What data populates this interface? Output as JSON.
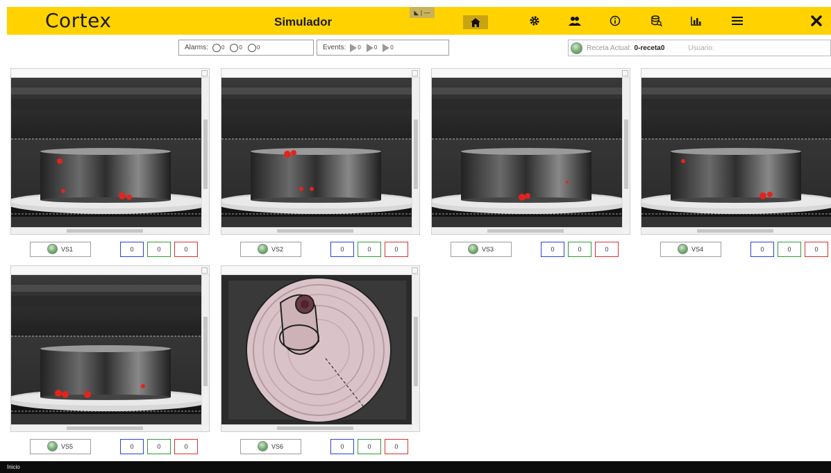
{
  "app": {
    "logo": "Cortex",
    "title": "Simulador",
    "min_label": "◣ | —"
  },
  "nav": [
    {
      "name": "home",
      "glyph": "⌂"
    },
    {
      "name": "settings",
      "glyph": "⚙"
    },
    {
      "name": "users",
      "glyph": "⚇"
    },
    {
      "name": "info",
      "glyph": "ⓘ"
    },
    {
      "name": "database",
      "glyph": "⛁"
    },
    {
      "name": "chart",
      "glyph": "▇"
    },
    {
      "name": "menu",
      "glyph": "☰"
    },
    {
      "name": "close",
      "glyph": "✖"
    }
  ],
  "alarms": {
    "label": "Alarms:",
    "counts": [
      "0",
      "0",
      "0"
    ]
  },
  "events": {
    "label": "Events:",
    "counts": [
      "0",
      "0",
      "0"
    ]
  },
  "recipe": {
    "label": "Receta Actual:",
    "value": "0-receta0",
    "user_label": "Usuario:"
  },
  "cameras": [
    {
      "name": "VS1",
      "counts": [
        "0",
        "0",
        "0"
      ],
      "view": "side"
    },
    {
      "name": "VS2",
      "counts": [
        "0",
        "0",
        "0"
      ],
      "view": "side"
    },
    {
      "name": "VS3",
      "counts": [
        "0",
        "0",
        "0"
      ],
      "view": "side"
    },
    {
      "name": "VS4",
      "counts": [
        "0",
        "0",
        "0"
      ],
      "view": "side"
    },
    {
      "name": "VS5",
      "counts": [
        "0",
        "0",
        "0"
      ],
      "view": "side"
    },
    {
      "name": "VS6",
      "counts": [
        "0",
        "0",
        "0"
      ],
      "view": "top"
    }
  ],
  "status": {
    "text": "Inicio"
  },
  "colors": {
    "accent": "#ffd200",
    "counter_blue": "#2c3fd8",
    "counter_green": "#2e9a35",
    "counter_red": "#d83030",
    "status_ok": "#6fae6f"
  }
}
